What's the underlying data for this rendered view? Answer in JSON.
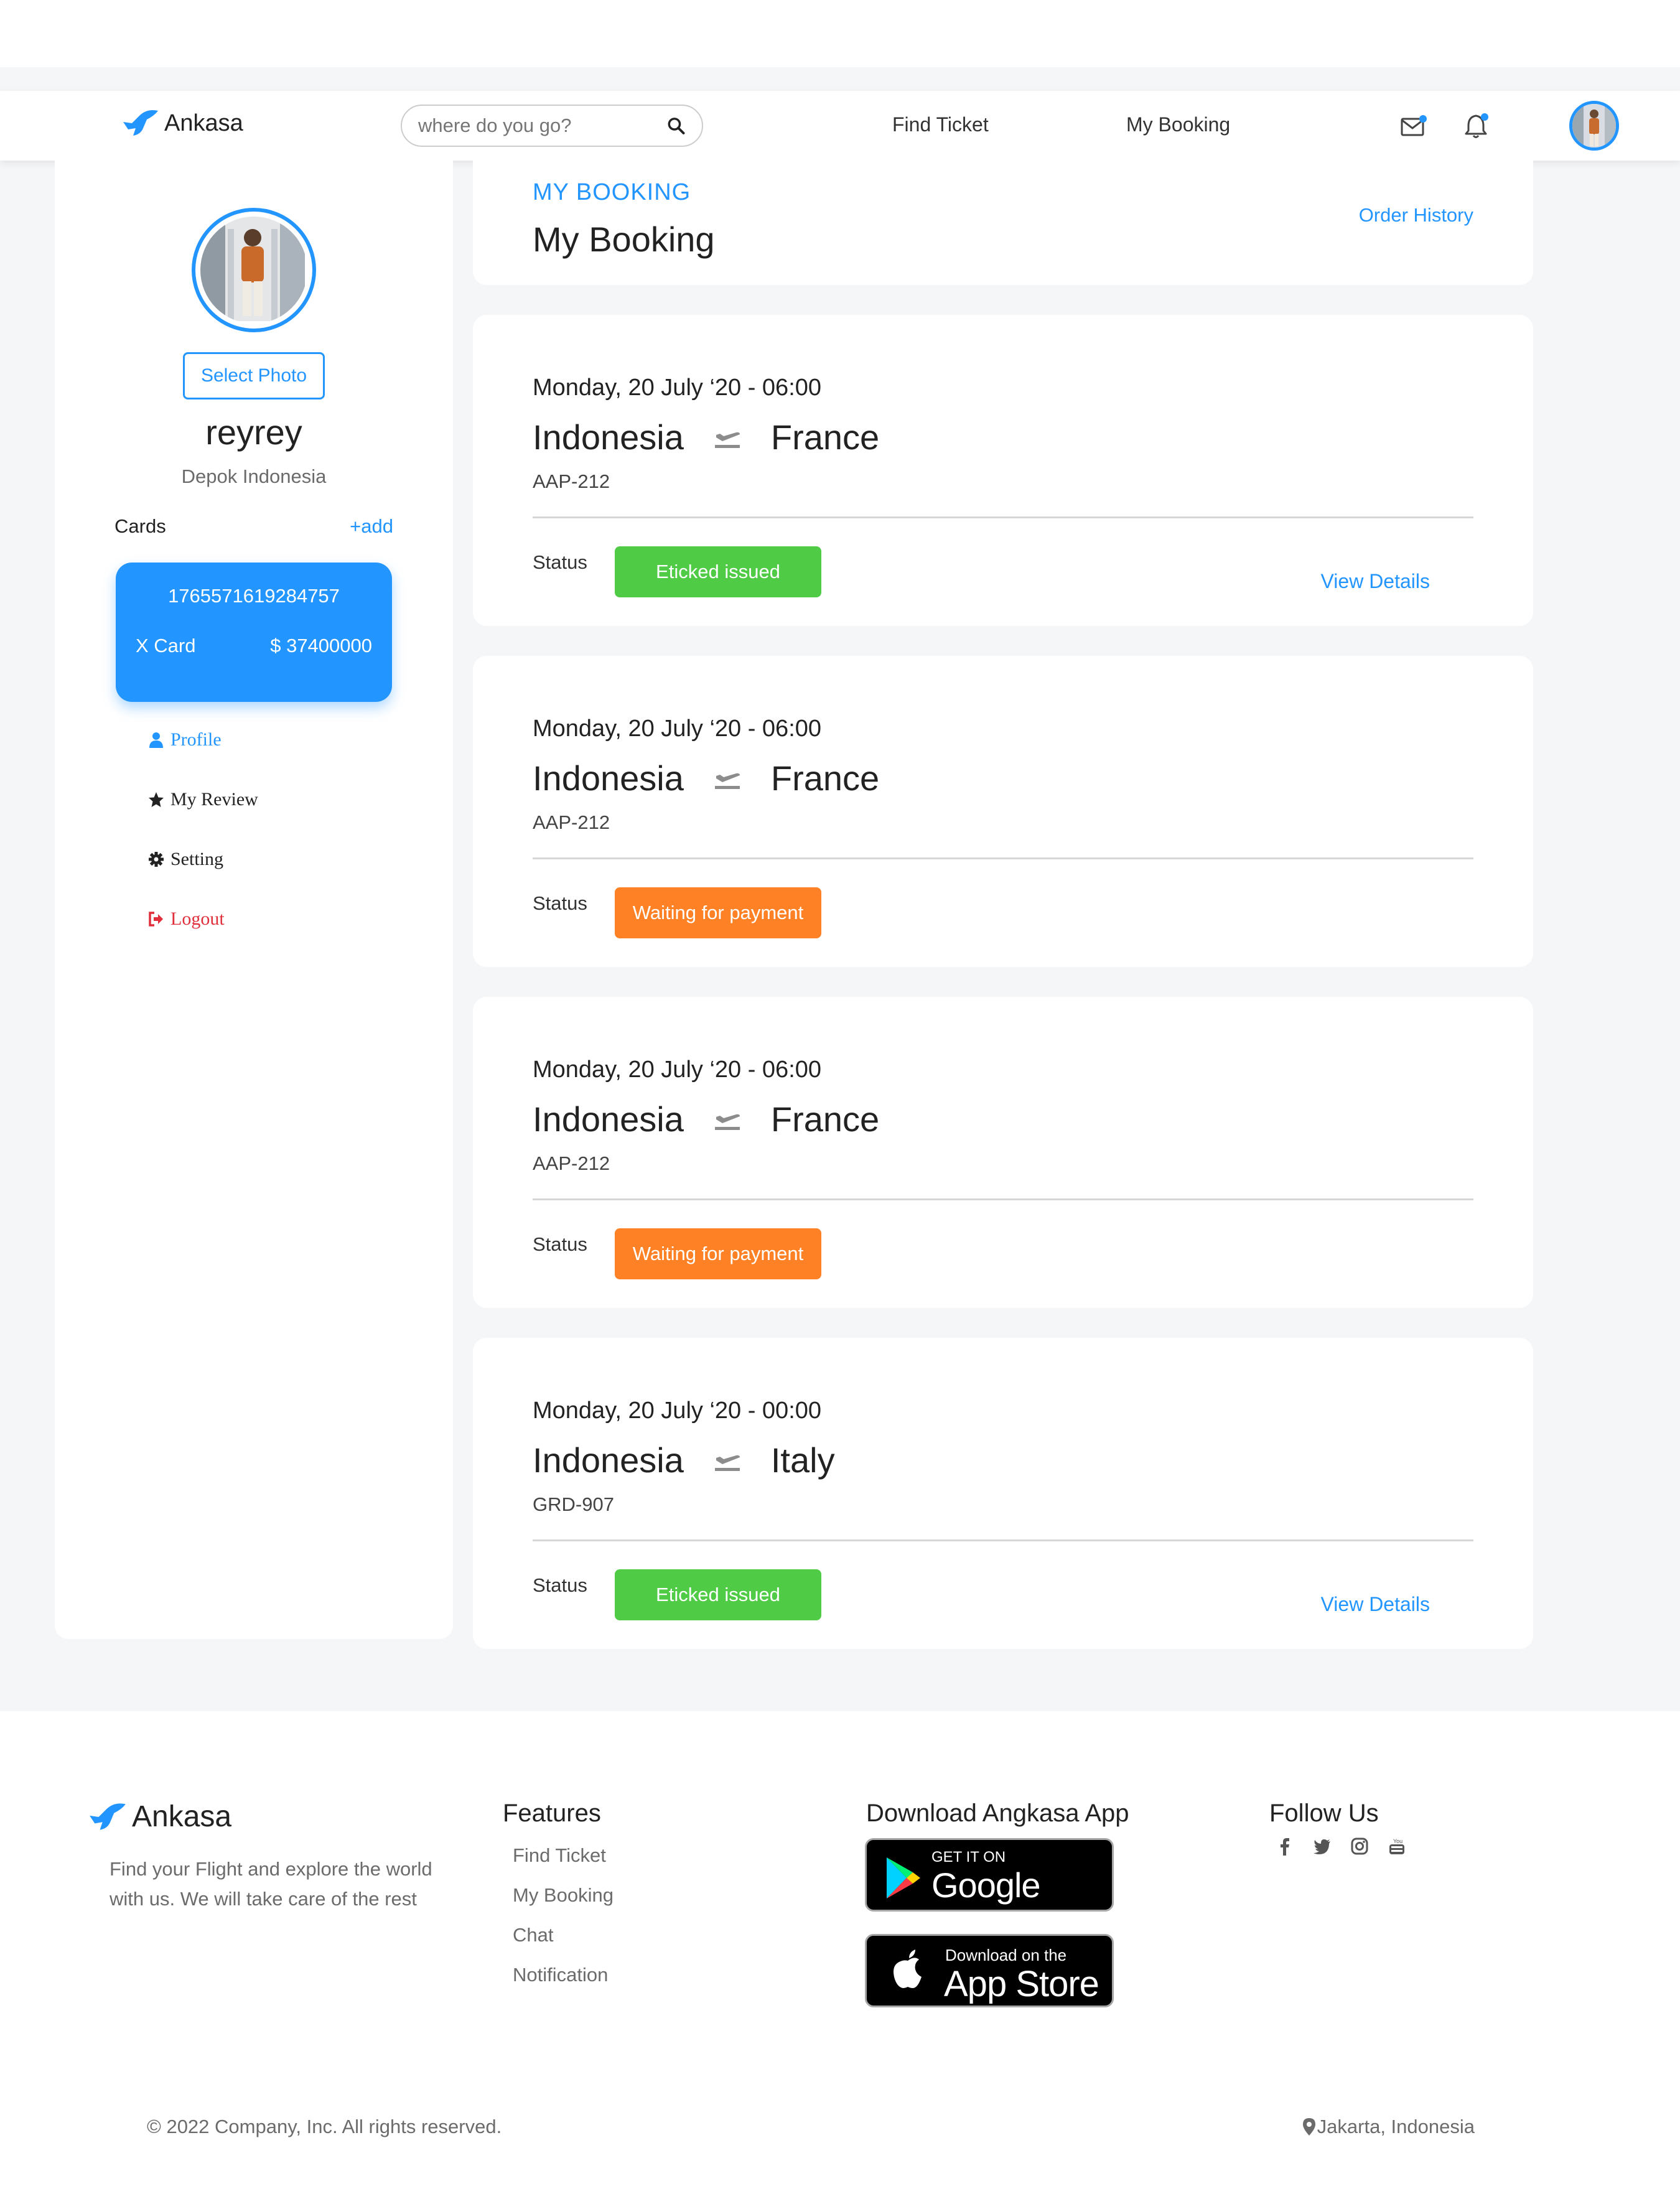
{
  "brand": {
    "name": "Ankasa",
    "color": "#2395ff"
  },
  "navbar": {
    "search_placeholder": "where do you go?",
    "links": [
      "Find Ticket",
      "My Booking"
    ]
  },
  "sidebar": {
    "select_photo_label": "Select Photo",
    "user_name": "reyrey",
    "user_location": "Depok Indonesia",
    "cards_label": "Cards",
    "add_label": "+add",
    "card": {
      "number": "1765571619284757",
      "name": "X Card",
      "balance": "$ 37400000"
    },
    "menu": [
      {
        "label": "Profile",
        "icon": "user-icon",
        "color": "#2395ff"
      },
      {
        "label": "My Review",
        "icon": "star-icon",
        "color": "#222222"
      },
      {
        "label": "Setting",
        "icon": "gear-icon",
        "color": "#222222"
      },
      {
        "label": "Logout",
        "icon": "sign-out-icon",
        "color": "#e02f3b"
      }
    ]
  },
  "main": {
    "section_label": "MY BOOKING",
    "title": "My Booking",
    "order_history_label": "Order History",
    "status_label": "Status",
    "view_details_label": "View Details",
    "bookings": [
      {
        "date": "Monday, 20 July ‘20 - 06:00",
        "from": "Indonesia",
        "to": "France",
        "code": "AAP-212",
        "status": "Eticked issued",
        "status_color": "#4fcb45"
      },
      {
        "date": "Monday, 20 July ‘20 - 06:00",
        "from": "Indonesia",
        "to": "France",
        "code": "AAP-212",
        "status": "Waiting for payment",
        "status_color": "#ff8125"
      },
      {
        "date": "Monday, 20 July ‘20 - 06:00",
        "from": "Indonesia",
        "to": "France",
        "code": "AAP-212",
        "status": "Waiting for payment",
        "status_color": "#ff8125"
      },
      {
        "date": "Monday, 20 July ‘20 - 00:00",
        "from": "Indonesia",
        "to": "Italy",
        "code": "GRD-907",
        "status": "Eticked issued",
        "status_color": "#4fcb45"
      }
    ]
  },
  "footer": {
    "description": "Find your Flight and explore the world with us. We will take care of the rest",
    "features_title": "Features",
    "features": [
      "Find Ticket",
      "My Booking",
      "Chat",
      "Notification"
    ],
    "download_title": "Download Angkasa App",
    "google_play": {
      "small": "GET IT ON",
      "big": "Google Play"
    },
    "app_store": {
      "small": "Download on the",
      "big": "App Store"
    },
    "follow_title": "Follow Us",
    "social_icons": [
      "facebook-icon",
      "twitter-icon",
      "instagram-icon",
      "youtube-icon"
    ],
    "copyright": "© 2022 Company, Inc. All rights reserved.",
    "location": "Jakarta, Indonesia"
  }
}
